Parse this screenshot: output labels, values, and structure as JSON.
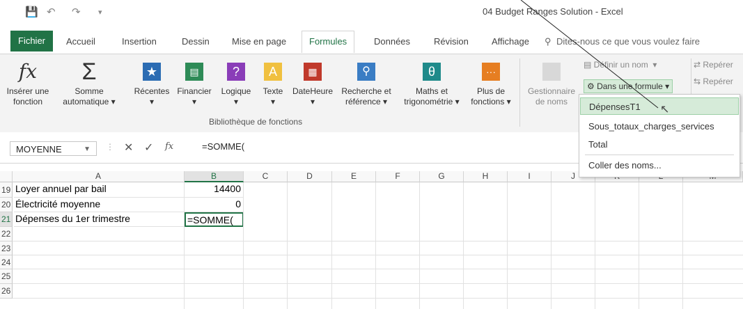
{
  "window": {
    "title": "04 Budget Ranges Solution - Excel"
  },
  "tabs": [
    {
      "label": "Fichier"
    },
    {
      "label": "Accueil"
    },
    {
      "label": "Insertion"
    },
    {
      "label": "Dessin"
    },
    {
      "label": "Mise en page"
    },
    {
      "label": "Formules"
    },
    {
      "label": "Données"
    },
    {
      "label": "Révision"
    },
    {
      "label": "Affichage"
    }
  ],
  "tell_me": "Dites-nous ce que vous voulez faire",
  "ribbon": {
    "insert_function": "Insérer une fonction",
    "autosum": "Somme automatique",
    "recent": "Récentes",
    "financial": "Financier",
    "logical": "Logique",
    "text": "Texte",
    "datetime": "DateHeure",
    "lookup": "Recherche et référence",
    "math": "Maths et trigonométrie",
    "more": "Plus de fonctions",
    "group_label": "Bibliothèque de fonctions",
    "name_manager": "Gestionnaire de noms",
    "define_name": "Définir un nom",
    "use_in_formula": "Dans une formule",
    "trace_label": "Repérer"
  },
  "formula_bar": {
    "name_box": "MOYENNE",
    "fx": "fx",
    "value": "=SOMME("
  },
  "columns": [
    "A",
    "B",
    "C",
    "D",
    "E",
    "F",
    "G",
    "H",
    "I",
    "J",
    "K",
    "L",
    "M"
  ],
  "rows": [
    {
      "num": "19",
      "a": "Loyer annuel par bail",
      "b": "14400"
    },
    {
      "num": "20",
      "a": "Électricité moyenne",
      "b": "0"
    },
    {
      "num": "21",
      "a": "Dépenses du 1er trimestre",
      "b": "=SOMME("
    },
    {
      "num": "22",
      "a": "",
      "b": ""
    },
    {
      "num": "23",
      "a": "",
      "b": ""
    },
    {
      "num": "24",
      "a": "",
      "b": ""
    },
    {
      "num": "25",
      "a": "",
      "b": ""
    },
    {
      "num": "26",
      "a": "",
      "b": ""
    }
  ],
  "dropdown": [
    {
      "label": "DépensesT1"
    },
    {
      "label": "Sous_totaux_charges_services"
    },
    {
      "label": "Total"
    },
    {
      "label": "Coller des noms..."
    }
  ],
  "colors": {
    "accent": "#217346",
    "highlight": "#d6ebd9"
  }
}
